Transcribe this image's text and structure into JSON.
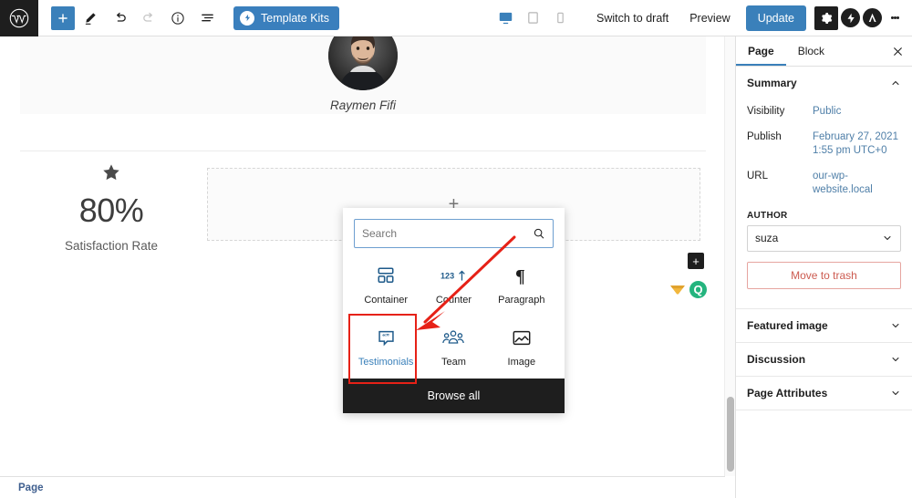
{
  "topbar": {
    "logo_icon": "wordpress-logo-icon",
    "left_tools": [
      {
        "name": "add-block-button",
        "icon": "plus-icon",
        "label": "+",
        "state": "primary"
      },
      {
        "name": "tools-button",
        "icon": "pencil-icon",
        "label": "",
        "state": "default"
      },
      {
        "name": "undo-button",
        "icon": "undo-icon",
        "label": "",
        "state": "default"
      },
      {
        "name": "redo-button",
        "icon": "redo-icon",
        "label": "",
        "state": "disabled"
      },
      {
        "name": "details-button",
        "icon": "info-circle-icon",
        "label": "",
        "state": "default"
      },
      {
        "name": "list-view-button",
        "icon": "list-view-icon",
        "label": "",
        "state": "default"
      }
    ],
    "template_kits_label": "Template Kits",
    "devices": [
      {
        "name": "preview-desktop",
        "icon": "desktop-icon",
        "active": true
      },
      {
        "name": "preview-tablet",
        "icon": "tablet-icon",
        "active": false
      },
      {
        "name": "preview-mobile",
        "icon": "mobile-icon",
        "active": false
      }
    ],
    "switch_to_draft_label": "Switch to draft",
    "preview_label": "Preview",
    "update_label": "Update",
    "settings_icon": "gear-icon",
    "plugin_logos": [
      {
        "name": "jetpack-logo-icon",
        "glyph": "⚡"
      },
      {
        "name": "astra-logo-icon",
        "glyph": "A"
      }
    ],
    "options_icon": "kebab-menu-icon"
  },
  "canvas": {
    "person_name": "Raymen Fifi",
    "avatar_name": "avatar-image",
    "stat": {
      "icon": "star-icon",
      "value": "80%",
      "label": "Satisfaction Rate"
    },
    "appender_plus": "+",
    "float_plus": "+",
    "badge_green_glyph": "Q"
  },
  "inserter": {
    "search": {
      "placeholder": "Search",
      "value": "",
      "icon": "search-icon"
    },
    "blocks": [
      {
        "name": "block-container",
        "label": "Container",
        "icon": "container-icon",
        "selected": false
      },
      {
        "name": "block-counter",
        "label": "Counter",
        "icon": "counter-icon",
        "selected": false
      },
      {
        "name": "block-paragraph",
        "label": "Paragraph",
        "icon": "paragraph-icon",
        "selected": false
      },
      {
        "name": "block-testimonials",
        "label": "Testimonials",
        "icon": "testimonials-icon",
        "selected": true
      },
      {
        "name": "block-team",
        "label": "Team",
        "icon": "team-icon",
        "selected": false
      },
      {
        "name": "block-image",
        "label": "Image",
        "icon": "image-icon",
        "selected": false
      }
    ],
    "browse_all_label": "Browse all",
    "annotation": {
      "name": "red-arrow-annotation",
      "color": "#e62117"
    }
  },
  "sidebar": {
    "tabs": [
      {
        "name": "tab-page",
        "label": "Page",
        "active": true
      },
      {
        "name": "tab-block",
        "label": "Block",
        "active": false
      }
    ],
    "close_icon": "close-icon",
    "summary": {
      "title": "Summary",
      "chevron": "chevron-up-icon",
      "rows": [
        {
          "key": "Visibility",
          "value": "Public"
        },
        {
          "key": "Publish",
          "value": "February 27, 2021 1:55 pm UTC+0"
        },
        {
          "key": "URL",
          "value": "our-wp-website.local"
        }
      ],
      "author_label": "AUTHOR",
      "author_value": "suza",
      "author_chevron": "chevron-down-icon",
      "trash_label": "Move to trash"
    },
    "sections": [
      {
        "name": "section-featured-image",
        "title": "Featured image",
        "chevron": "chevron-down-icon"
      },
      {
        "name": "section-discussion",
        "title": "Discussion",
        "chevron": "chevron-down-icon"
      },
      {
        "name": "section-page-attributes",
        "title": "Page Attributes",
        "chevron": "chevron-down-icon"
      }
    ]
  },
  "bottombar": {
    "breadcrumb": "Page"
  },
  "colors": {
    "accent": "#3a80ba",
    "dark": "#1e1e1e",
    "link": "#4f7fa8",
    "danger": "#cc5b50",
    "annotation": "#e62117",
    "green": "#24b47e",
    "yellow": "#f2b73d"
  }
}
